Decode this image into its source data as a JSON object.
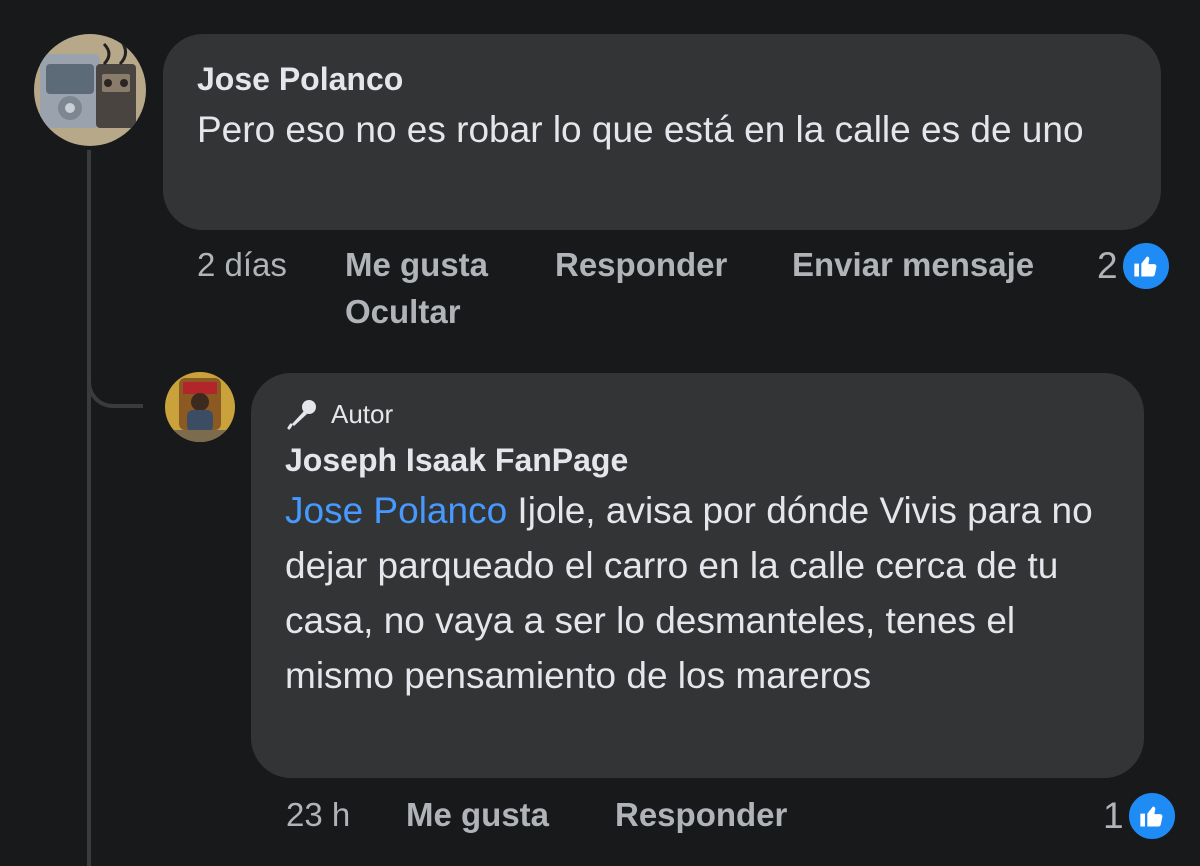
{
  "comments": [
    {
      "author": "Jose Polanco",
      "text": "Pero eso no es robar lo que está en la calle es de uno",
      "time": "2 días",
      "like_label": "Me gusta",
      "reply_label": "Responder",
      "message_label": "Enviar mensaje",
      "hide_label": "Ocultar",
      "reaction_count": "2",
      "avatar_icon": "cassette-walkman-avatar"
    },
    {
      "badge": "Autor",
      "badge_icon": "microphone-icon",
      "author": "Joseph Isaak FanPage",
      "mention": "Jose Polanco",
      "text": " Ijole, avisa por dónde Vivis para no dejar parqueado el carro en la calle cerca de tu casa, no vaya a ser lo desmanteles, tenes el mismo pensamiento de los mareros",
      "time": "23 h",
      "like_label": "Me gusta",
      "reply_label": "Responder",
      "reaction_count": "1",
      "avatar_icon": "person-on-throne-avatar"
    }
  ],
  "colors": {
    "background": "#18191b",
    "bubble": "#333436",
    "mention": "#4599ff",
    "like": "#1f8cf6",
    "secondary_text": "#b0b3b8"
  }
}
